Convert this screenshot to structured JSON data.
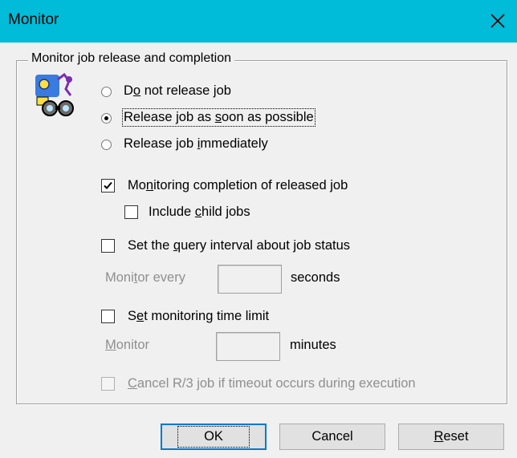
{
  "window": {
    "title": "Monitor",
    "close_icon": "close-icon"
  },
  "group": {
    "legend": "Monitor job release and completion",
    "illustration_icon": "job-monitor-icon"
  },
  "release_options": [
    {
      "pre": "D",
      "ul": "o",
      "post": " not release job",
      "selected": false
    },
    {
      "pre": "Release job as ",
      "ul": "s",
      "post": "oon as possible",
      "selected": true
    },
    {
      "pre": "Release job ",
      "ul": "i",
      "post": "mmediately",
      "selected": false
    }
  ],
  "monitor_completion": {
    "pre": "Mo",
    "ul": "n",
    "post": "itoring completion of released job",
    "checked": true
  },
  "include_child": {
    "pre": "Include ",
    "ul": "c",
    "post": "hild jobs",
    "checked": false
  },
  "query_interval": {
    "pre": "Set the ",
    "ul": "q",
    "post": "uery interval about job status",
    "checked": false
  },
  "monitor_every": {
    "pre": "Moni",
    "ul": "t",
    "post": "or every",
    "value": "",
    "unit": "seconds"
  },
  "time_limit": {
    "pre": "S",
    "ul": "e",
    "post": "t monitoring time limit",
    "checked": false
  },
  "monitor_minutes": {
    "pre": "",
    "ul": "M",
    "post": "onitor",
    "value": "",
    "unit": "minutes"
  },
  "cancel_r3": {
    "pre": "",
    "ul": "C",
    "post": "ancel R/3 job if timeout occurs during execution",
    "checked": false
  },
  "buttons": {
    "ok": "OK",
    "cancel": "Cancel",
    "reset_pre": "",
    "reset_ul": "R",
    "reset_post": "eset"
  },
  "colors": {
    "titlebar": "#00bcd8",
    "dialog_bg": "#f0f0f0",
    "default_button_border": "#0078d7",
    "disabled_text": "#8f8f8f"
  }
}
